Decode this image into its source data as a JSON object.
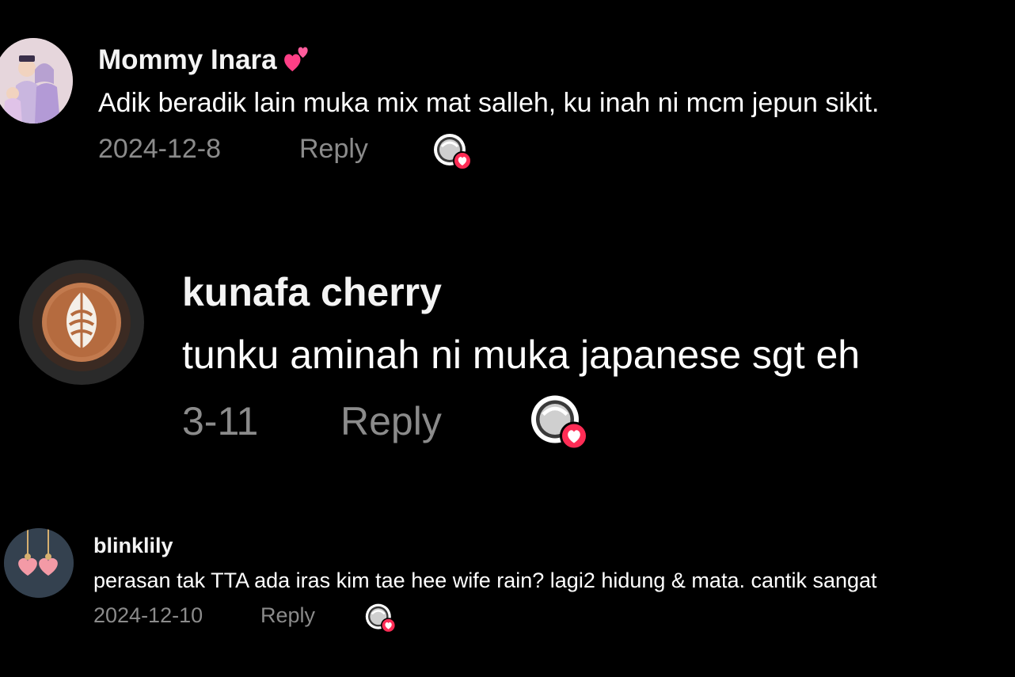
{
  "comments": [
    {
      "username": "Mommy Inara",
      "username_emoji": "two-hearts-icon",
      "text": "Adik beradik lain muka mix mat salleh, ku inah ni mcm jepun sikit.",
      "date": "2024-12-8",
      "reply_label": "Reply",
      "avatar": "family-illustration-avatar"
    },
    {
      "username": "kunafa cherry",
      "text": "tunku aminah ni muka japanese sgt eh",
      "date": "3-11",
      "reply_label": "Reply",
      "avatar": "latte-art-avatar"
    },
    {
      "username": "blinklily",
      "text": "perasan tak TTA ada iras kim tae hee wife rain? lagi2 hidung & mata. cantik sangat",
      "date": "2024-12-10",
      "reply_label": "Reply",
      "avatar": "heart-keychain-avatar"
    }
  ],
  "colors": {
    "background": "#000000",
    "text": "#ffffff",
    "meta": "#8b8b8b",
    "heart_badge": "#fe2c55"
  }
}
